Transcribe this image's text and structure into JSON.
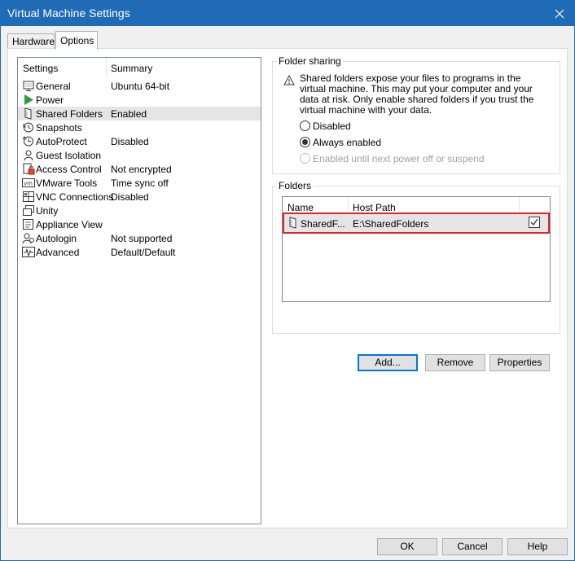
{
  "window": {
    "title": "Virtual Machine Settings"
  },
  "tabs": [
    {
      "label": "Hardware"
    },
    {
      "label": "Options"
    }
  ],
  "settings_list": {
    "header": {
      "settings": "Settings",
      "summary": "Summary"
    },
    "items": [
      {
        "label": "General",
        "summary": "Ubuntu 64-bit",
        "icon": "monitor-icon"
      },
      {
        "label": "Power",
        "summary": "",
        "icon": "power-play-icon"
      },
      {
        "label": "Shared Folders",
        "summary": "Enabled",
        "icon": "shared-folder-icon"
      },
      {
        "label": "Snapshots",
        "summary": "",
        "icon": "snapshot-icon"
      },
      {
        "label": "AutoProtect",
        "summary": "Disabled",
        "icon": "autoprotect-clock-icon"
      },
      {
        "label": "Guest Isolation",
        "summary": "",
        "icon": "guest-isolation-icon"
      },
      {
        "label": "Access Control",
        "summary": "Not encrypted",
        "icon": "lock-icon"
      },
      {
        "label": "VMware Tools",
        "summary": "Time sync off",
        "icon": "vmware-tools-icon"
      },
      {
        "label": "VNC Connections",
        "summary": "Disabled",
        "icon": "vnc-icon"
      },
      {
        "label": "Unity",
        "summary": "",
        "icon": "unity-icon"
      },
      {
        "label": "Appliance View",
        "summary": "",
        "icon": "appliance-view-icon"
      },
      {
        "label": "Autologin",
        "summary": "Not supported",
        "icon": "autologin-icon"
      },
      {
        "label": "Advanced",
        "summary": "Default/Default",
        "icon": "advanced-waveform-icon"
      }
    ]
  },
  "folder_sharing": {
    "title": "Folder sharing",
    "warning": "Shared folders expose your files to programs in the virtual machine. This may put your computer and your data at risk. Only enable shared folders if you trust the virtual machine with your data.",
    "options": [
      {
        "label": "Disabled"
      },
      {
        "label": "Always enabled"
      },
      {
        "label": "Enabled until next power off or suspend"
      }
    ],
    "selected": "Always enabled"
  },
  "folders": {
    "title": "Folders",
    "columns": {
      "name": "Name",
      "host_path": "Host Path"
    },
    "rows": [
      {
        "name": "SharedF...",
        "host_path": "E:\\SharedFolders",
        "enabled": true
      }
    ],
    "buttons": {
      "add": "Add...",
      "remove": "Remove",
      "properties": "Properties"
    }
  },
  "dialog_buttons": {
    "ok": "OK",
    "cancel": "Cancel",
    "help": "Help"
  },
  "colors": {
    "titlebar": "#1f6bb5",
    "highlight": "#d9262a",
    "selection": "#e5e5e5"
  }
}
